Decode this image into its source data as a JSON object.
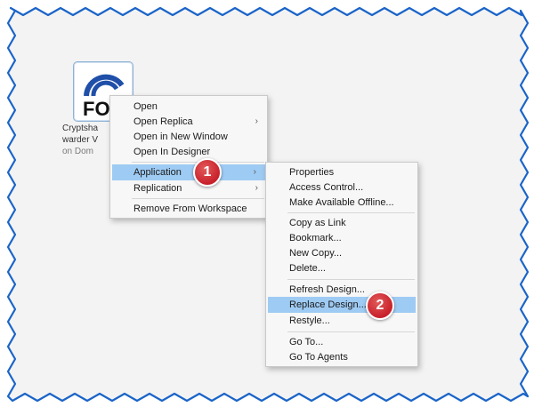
{
  "tile": {
    "logo_text": "FO",
    "caption_line1": "Cryptsha",
    "caption_line2": "warder V",
    "caption_line3": "on Dom"
  },
  "context_menu": {
    "items": [
      {
        "label": "Open"
      },
      {
        "label": "Open Replica",
        "submenu": true
      },
      {
        "label": "Open in New Window"
      },
      {
        "label": "Open In Designer"
      },
      {
        "label": "Application",
        "submenu": true,
        "selected": true
      },
      {
        "label": "Replication",
        "submenu": true
      },
      {
        "label": "Remove From Workspace"
      }
    ],
    "submenu_arrow": "›"
  },
  "application_submenu": {
    "items": [
      {
        "label": "Properties"
      },
      {
        "label": "Access Control..."
      },
      {
        "label": "Make Available Offline..."
      },
      {
        "label": "Copy as Link"
      },
      {
        "label": "Bookmark..."
      },
      {
        "label": "New Copy..."
      },
      {
        "label": "Delete..."
      },
      {
        "label": "Refresh Design..."
      },
      {
        "label": "Replace Design...",
        "selected": true
      },
      {
        "label": "Restyle..."
      },
      {
        "label": "Go To..."
      },
      {
        "label": "Go To Agents"
      }
    ]
  },
  "badges": {
    "step1": "1",
    "step2": "2"
  },
  "colors": {
    "selection": "#9ecbf3",
    "badge": "#c8202a",
    "logo_blue": "#1f4fa8",
    "border_blue": "#1a64c8"
  }
}
